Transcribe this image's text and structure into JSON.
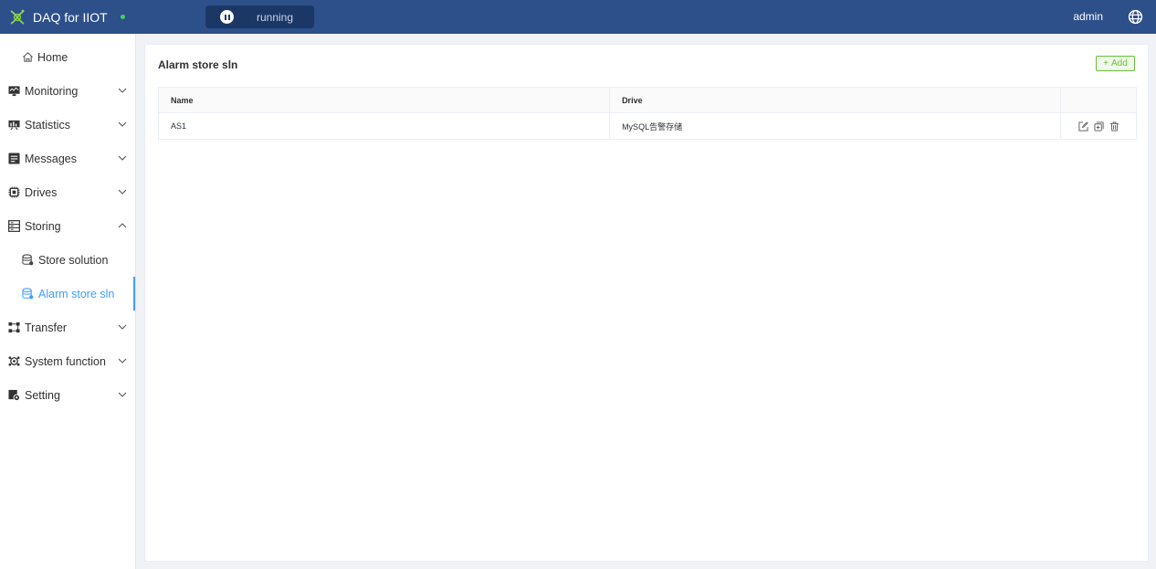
{
  "header": {
    "app_title": "DAQ for IIOT",
    "run_state": "running",
    "user": "admin"
  },
  "sidebar": {
    "items": [
      {
        "label": "Home",
        "icon": "home-icon"
      },
      {
        "label": "Monitoring",
        "icon": "monitor-icon"
      },
      {
        "label": "Statistics",
        "icon": "statistics-icon"
      },
      {
        "label": "Messages",
        "icon": "messages-icon"
      },
      {
        "label": "Drives",
        "icon": "chip-icon"
      },
      {
        "label": "Storing",
        "icon": "storing-icon"
      },
      {
        "label": "Store solution",
        "icon": "database-icon"
      },
      {
        "label": "Alarm store sln",
        "icon": "database-icon"
      },
      {
        "label": "Transfer",
        "icon": "transfer-icon"
      },
      {
        "label": "System function",
        "icon": "system-icon"
      },
      {
        "label": "Setting",
        "icon": "setting-icon"
      }
    ]
  },
  "main": {
    "title": "Alarm store sln",
    "add_label": "Add",
    "table": {
      "columns": [
        "Name",
        "Drive",
        ""
      ],
      "rows": [
        {
          "name": "AS1",
          "drive": "MySQL告警存储"
        }
      ]
    }
  },
  "colors": {
    "header_bg": "#2d4f8a",
    "accent": "#409eff",
    "success": "#67c23a",
    "status_dot": "#3fd06a"
  }
}
